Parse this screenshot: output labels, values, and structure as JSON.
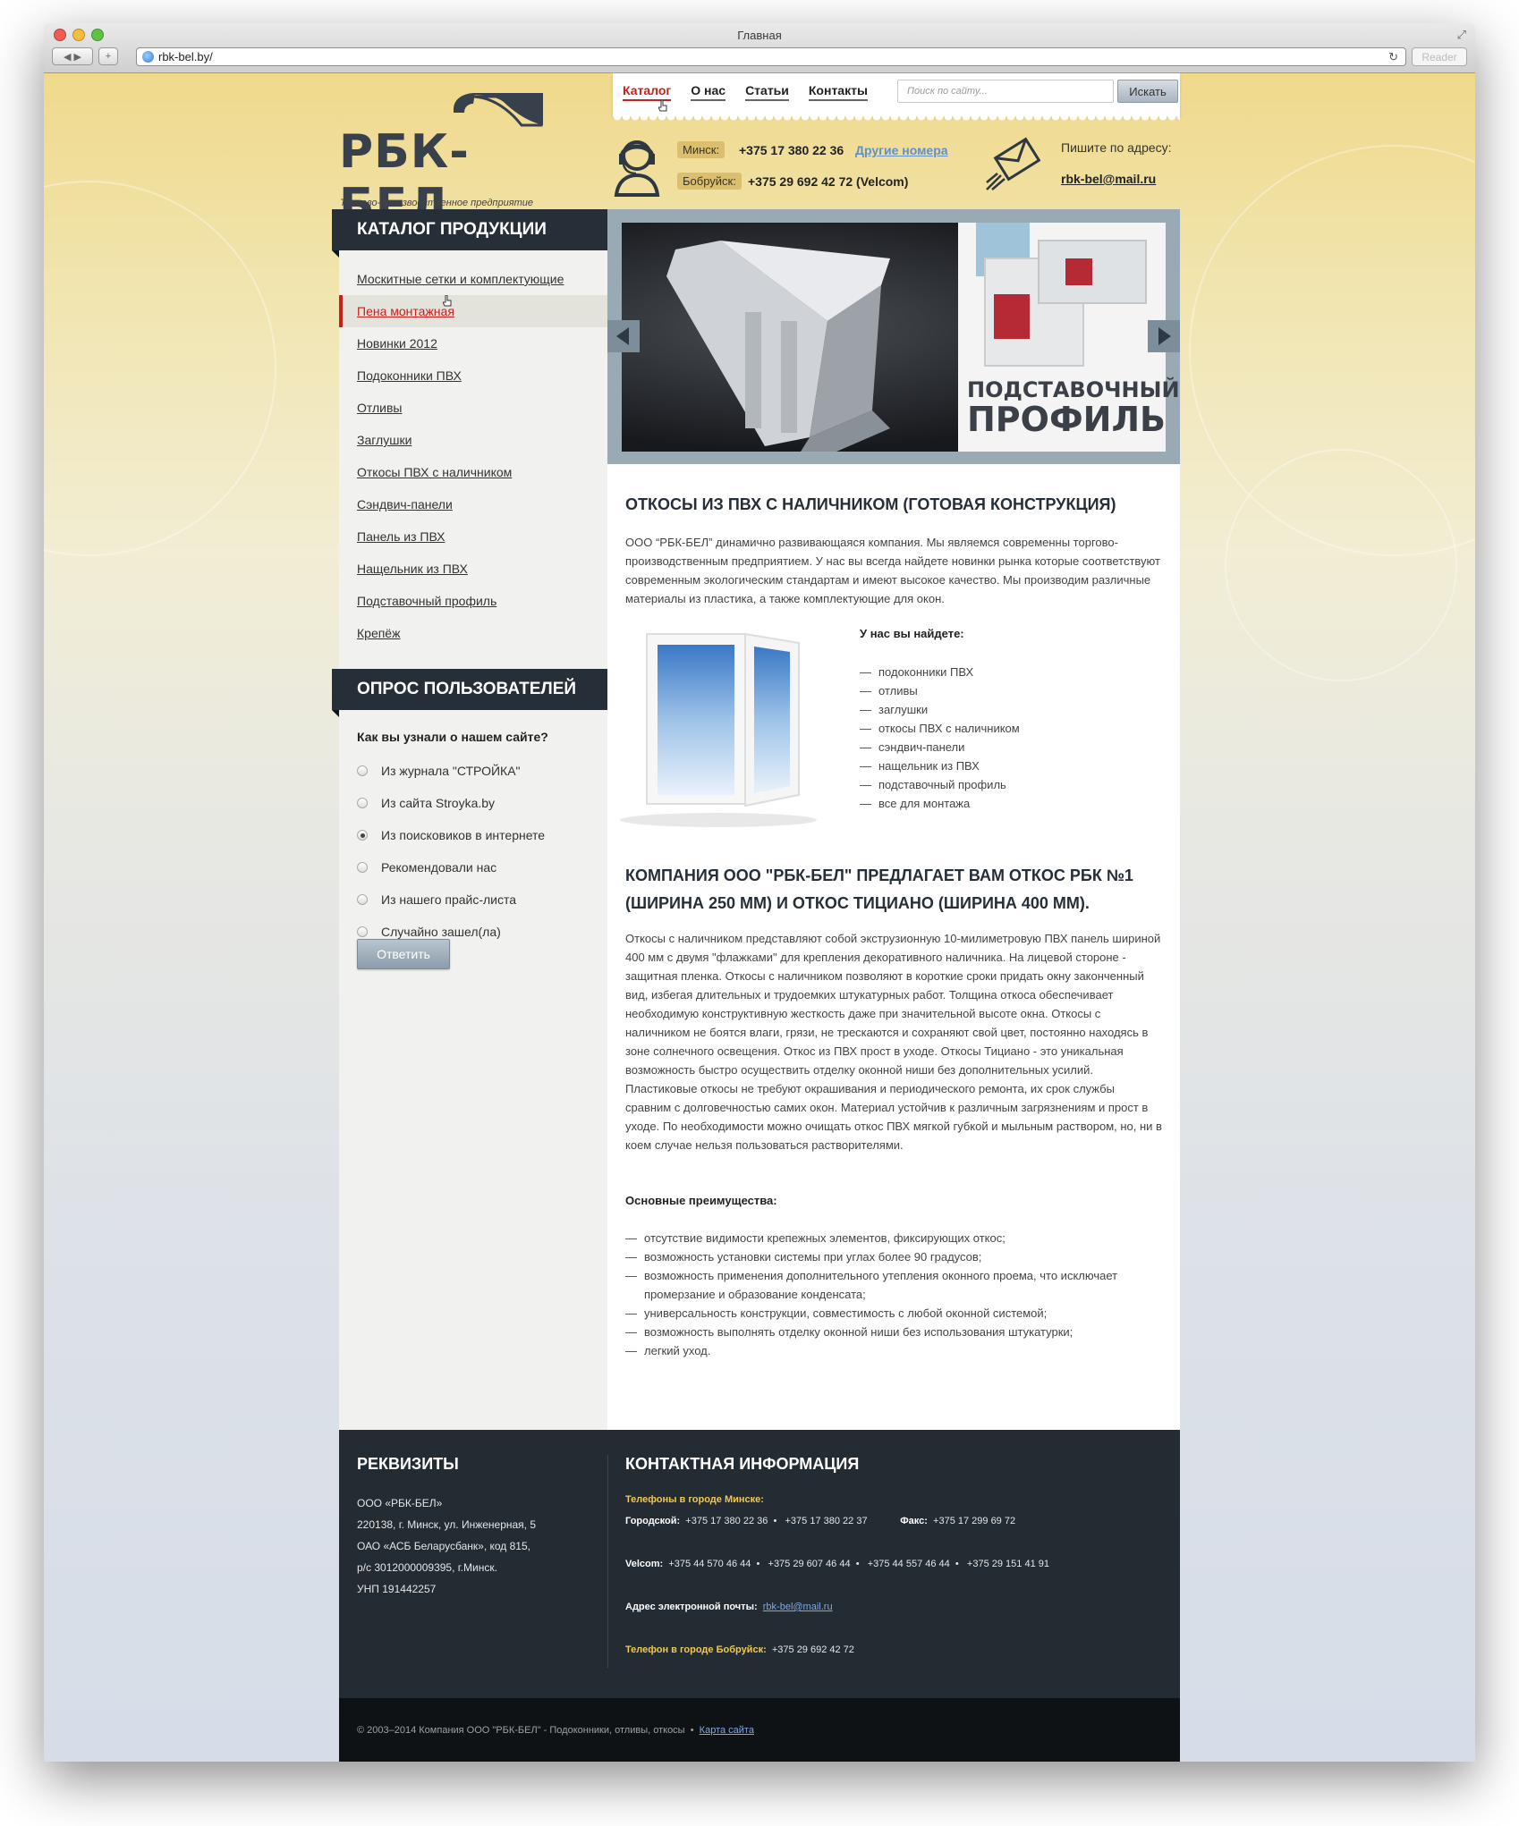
{
  "browser": {
    "window_title": "Главная",
    "url": "rbk-bel.by/",
    "reader_label": "Reader"
  },
  "header": {
    "logo_text": "РБК-БЕЛ",
    "logo_subtitle": "Торгово-производственное предприятие",
    "nav": [
      "Каталог",
      "О нас",
      "Статьи",
      "Контакты"
    ],
    "search_placeholder": "Поиск по сайту...",
    "search_button": "Искать",
    "city1": "Минск:",
    "phone1": "+375 17 380 22 36",
    "other_numbers": "Другие номера",
    "city2": "Бобруйск:",
    "phone2": "+375 29 692 42 72  (Velcom)",
    "write_label": "Пишите по адресу:",
    "email": "rbk-bel@mail.ru"
  },
  "sidebar": {
    "catalog_title": "КАТАЛОГ ПРОДУКЦИИ",
    "catalog_items": [
      "Москитные сетки и комплектующие",
      "Пена монтажная",
      "Новинки 2012",
      "Подоконники ПВХ",
      "Отливы",
      "Заглушки",
      "Откосы ПВХ с наличником",
      "Сэндвич-панели",
      "Панель из ПВХ",
      "Нащельник из ПВХ",
      "Подставочный профиль",
      "Крепёж"
    ],
    "poll_title": "ОПРОС ПОЛЬЗОВАТЕЛЕЙ",
    "poll_question": "Как вы узнали о нашем сайте?",
    "poll_options": [
      "Из журнала \"СТРОЙКА\"",
      "Из сайта Stroyka.by",
      "Из поисковиков в интернете",
      "Рекомендовали нас",
      "Из нашего прайс-листа",
      "Случайно зашел(ла)"
    ],
    "poll_button": "Ответить"
  },
  "slider": {
    "caption_line1": "ПОДСТАВОЧНЫЙ",
    "caption_line2": "ПРОФИЛЬ"
  },
  "content": {
    "title1": "ОТКОСЫ ИЗ ПВХ С НАЛИЧНИКОМ (ГОТОВАЯ КОНСТРУКЦИЯ)",
    "intro": "ООО “РБК-БЕЛ” динамично развивающаяся компания. Мы являемся современны торгово-производственным предприятием. У нас вы всегда найдете новинки рынка которые соответствуют современным экологическим стандартам и имеют высокое качество. Мы производим различные материалы из пластика, а также комплектующие для окон.",
    "find_title": "У нас вы найдете:",
    "find_items": [
      "подоконники ПВХ",
      "отливы",
      "заглушки",
      "откосы ПВХ с наличником",
      "сэндвич-панели",
      "нащельник из ПВХ",
      "подставочный профиль",
      "все для монтажа"
    ],
    "title2": "КОМПАНИЯ ООО \"РБК-БЕЛ\" ПРЕДЛАГАЕТ ВАМ ОТКОС РБК №1 (ШИРИНА 250 ММ) И ОТКОС ТИЦИАНО (ШИРИНА 400 ММ).",
    "body": "Откосы с наличником представляют собой экструзионную 10-милиметровую ПВХ панель шириной 400 мм с двумя \"флажками\" для крепления декоративного наличника. На лицевой стороне - защитная пленка. Откосы с наличником позволяют в короткие сроки придать окну законченный вид, избегая длительных и трудоемких штукатурных работ. Толщина откоса обеспечивает необходимую конструктивную жесткость даже при значительной высоте окна. Откосы с наличником не боятся влаги, грязи, не трескаются и сохраняют свой цвет, постоянно находясь в зоне солнечного освещения. Откос из ПВХ прост в уходе. Откосы Тициано - это уникальная возможность быстро осуществить отделку оконной ниши без дополнительных усилий. Пластиковые откосы не требуют окрашивания и периодического ремонта, их срок службы сравним с долговечностью самих окон. Материал устойчив к различным загрязнениям и прост в уходе. По необходимости можно очищать откос ПВХ мягкой губкой и мыльным раствором, но, ни в коем случае нельзя пользоваться растворителями.",
    "adv_title": "Основные преимущества:",
    "adv_items": [
      "отсутствие видимости крепежных элементов, фиксирующих откос;",
      "возможность установки системы при углах более 90 градусов;",
      "возможность применения дополнительного утепления оконного проема, что исключает промерзание и образование конденсата;",
      "универсальность конструкции, совместимость с любой оконной системой;",
      "возможность выполнять отделку оконной ниши без использования штукатурки;",
      "легкий уход."
    ]
  },
  "footer": {
    "req_title": "РЕКВИЗИТЫ",
    "req_lines": [
      "ООО «РБК-БЕЛ»",
      "220138, г. Минск, ул. Инженерная, 5",
      "ОАО «АСБ Беларусбанк», код 815,",
      "р/с 3012000009395, г.Минск.",
      "УНП 191442257"
    ],
    "contact_title": "КОНТАКТНАЯ ИНФОРМАЦИЯ",
    "minsk_label": "Телефоны в городе Минске:",
    "city_label": "Городской:",
    "city_phone1": "+375 17 380 22 36",
    "city_phone2": "+375 17 380 22 37",
    "fax_label": "Факс:",
    "fax": "+375 17 299 69 72",
    "velcom_label": "Velcom:",
    "velcom_phones": [
      "+375 44 570 46 44",
      "+375 29 607 46 44",
      "+375 44 557 46 44",
      "+375 29 151 41 91"
    ],
    "email_label": "Адрес электронной почты:",
    "email": "rbk-bel@mail.ru",
    "bobruisk_label": "Телефон в городе Бобруйск:",
    "bobruisk_phone": "+375 29 692 42 72",
    "copyright": "© 2003–2014  Компания ООО \"РБК-БЕЛ\" - Подоконники, отливы, откосы",
    "sitemap": "Карта сайта"
  },
  "colors": {
    "accent": "#c8201d",
    "dark": "#262e37",
    "link": "#5f8fd0",
    "footer_highlight": "#f2c94c"
  }
}
